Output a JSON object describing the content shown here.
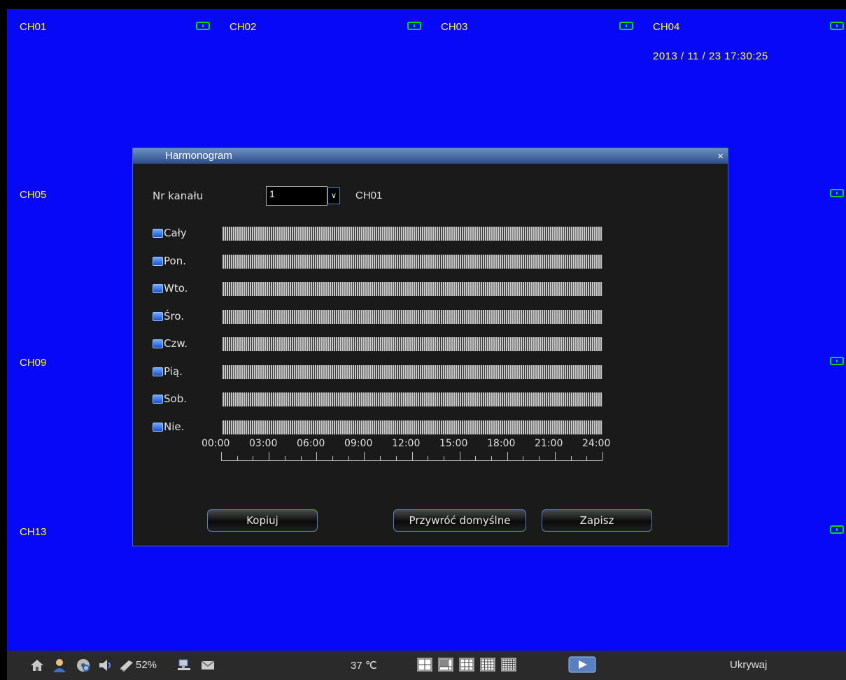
{
  "channels": {
    "top": [
      "CH01",
      "CH02",
      "CH03",
      "CH04"
    ],
    "left": [
      "CH05",
      "CH09",
      "CH13"
    ]
  },
  "datetime": "2013 / 11 / 23 17:30:25",
  "dialog": {
    "title": "Harmonogram",
    "close": "×",
    "channel_label": "Nr kanału",
    "channel_value": "1",
    "channel_name": "CH01",
    "channel_dropdown_glyph": "∨",
    "days": [
      "Cały",
      "Pon.",
      "Wto.",
      "Śro.",
      "Czw.",
      "Pią.",
      "Sob.",
      "Nie."
    ],
    "time_labels": [
      "00:00",
      "03:00",
      "06:00",
      "09:00",
      "12:00",
      "15:00",
      "18:00",
      "21:00",
      "24:00"
    ],
    "buttons": {
      "copy": "Kopiuj",
      "restore": "Przywróć domyślne",
      "save": "Zapisz"
    }
  },
  "taskbar": {
    "disk_percent": "52%",
    "temperature": "37 ℃",
    "hide": "Ukrywaj",
    "icons": [
      "home-icon",
      "user-icon",
      "disk-search-icon",
      "speaker-icon",
      "hdd-icon",
      "network-icon",
      "mail-icon"
    ]
  },
  "colors": {
    "background": "#0808f8",
    "channel_text": "#ffff00",
    "record_icon": "#00e000"
  }
}
